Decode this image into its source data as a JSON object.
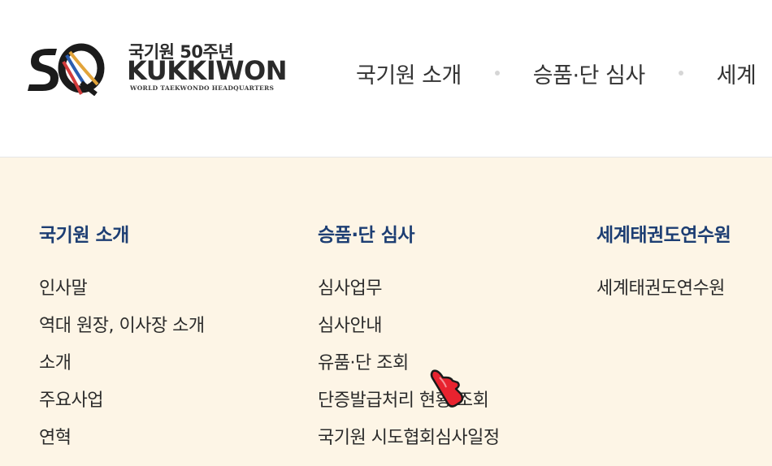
{
  "header": {
    "logo": {
      "anniversary": "국기원 50주년",
      "name": "KUKKIWON",
      "tagline": "WORLD TAEKWONDO HEADQUARTERS",
      "mark_text": "50",
      "colors": [
        "#1b1b1b",
        "#2a5db0",
        "#e2a43a",
        "#d23b3b"
      ]
    },
    "nav": [
      {
        "label": "국기원 소개"
      },
      {
        "label": "승품·단 심사"
      },
      {
        "label": "세계"
      }
    ]
  },
  "mega_menu": {
    "columns": [
      {
        "title": "국기원 소개",
        "items": [
          "인사말",
          "역대 원장, 이사장 소개",
          "소개",
          "주요사업",
          "연혁"
        ]
      },
      {
        "title": "승품·단 심사",
        "items": [
          "심사업무",
          "심사안내",
          "유품·단 조회",
          "단증발급처리 현황 조회",
          "국기원 시도협회심사일정"
        ]
      },
      {
        "title": "세계태권도연수원",
        "items": [
          "세계태권도연수원"
        ]
      }
    ]
  },
  "colors": {
    "mega_bg": "#fdf5e6",
    "title_blue": "#1d3e73",
    "cursor_red": "#e8232f"
  },
  "icons": {
    "cursor": "hand-pointer-cursor-icon",
    "separator": "dot-separator-icon"
  }
}
